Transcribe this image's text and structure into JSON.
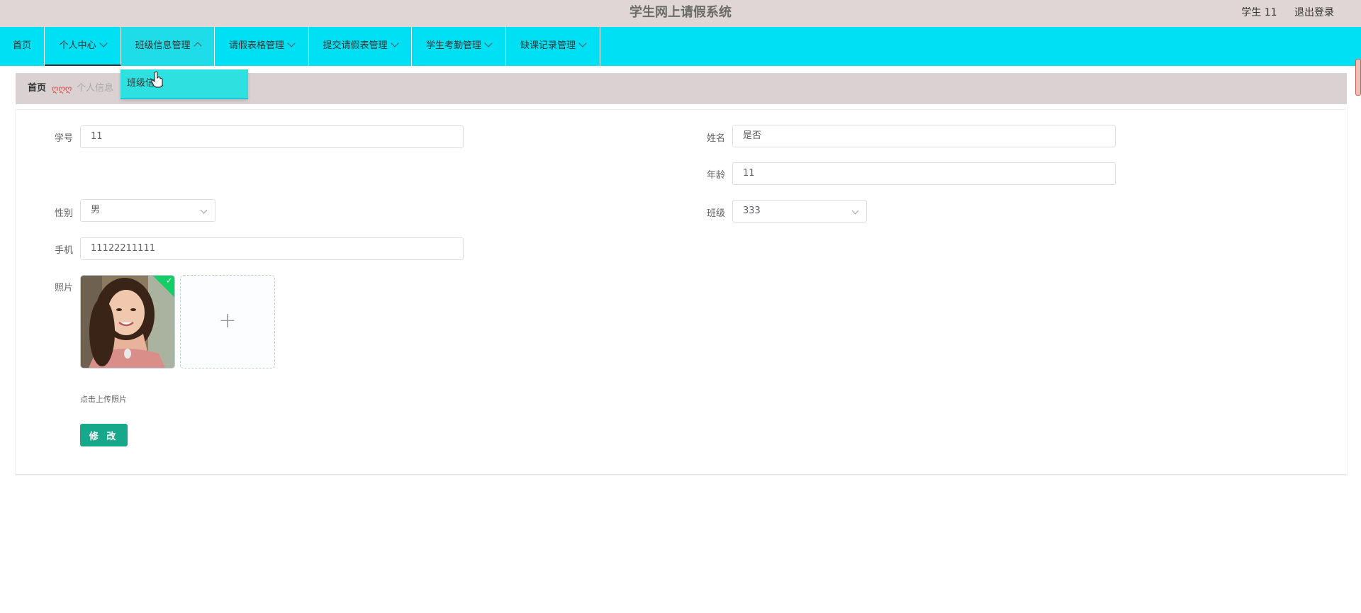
{
  "header": {
    "title": "学生网上请假系统",
    "user": "学生 11",
    "logout": "退出登录"
  },
  "nav": {
    "items": [
      {
        "label": "首页"
      },
      {
        "label": "个人中心"
      },
      {
        "label": "班级信息管理"
      },
      {
        "label": "请假表格管理"
      },
      {
        "label": "提交请假表管理"
      },
      {
        "label": "学生考勤管理"
      },
      {
        "label": "缺课记录管理"
      }
    ],
    "dropdown_item": "班级信息"
  },
  "breadcrumb": {
    "home": "首页",
    "separator": "ღღღ",
    "current": "个人信息"
  },
  "form": {
    "student_no": {
      "label": "学号",
      "value": "11"
    },
    "name": {
      "label": "姓名",
      "value": "是否"
    },
    "age": {
      "label": "年龄",
      "value": "11"
    },
    "gender": {
      "label": "性别",
      "value": "男"
    },
    "class": {
      "label": "班级",
      "value": "333"
    },
    "phone": {
      "label": "手机",
      "value": "11122211111"
    },
    "photo": {
      "label": "照片",
      "tip": "点击上传照片",
      "plus": "+",
      "check": "✓"
    },
    "submit": "修 改"
  },
  "colors": {
    "nav_bg": "#00e0f5",
    "header_bg": "#e0d6d6",
    "button_bg": "#17a88c"
  }
}
